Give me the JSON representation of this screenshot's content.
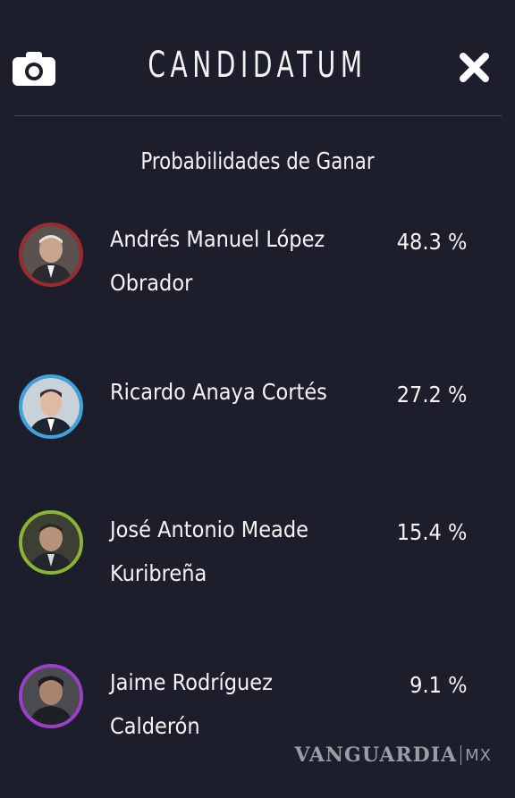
{
  "header": {
    "title": "CANDIDATUM",
    "camera_icon": "camera-icon",
    "close_icon": "close-icon"
  },
  "section_title": "Probabilidades de Ganar",
  "candidates": [
    {
      "name": "Andrés Manuel López\nObrador",
      "probability": "48.3 %",
      "ring_color": "#9e2a2f",
      "probability_value": 48.3
    },
    {
      "name": "Ricardo Anaya Cortés",
      "probability": "27.2 %",
      "ring_color": "#3ea3dc",
      "probability_value": 27.2
    },
    {
      "name": "José Antonio Meade\nKuribreña",
      "probability": "15.4 %",
      "ring_color": "#8ab531",
      "probability_value": 15.4
    },
    {
      "name": "Jaime Rodríguez\nCalderón",
      "probability": "9.1 %",
      "ring_color": "#9b3fc4",
      "probability_value": 9.1
    }
  ],
  "watermark": {
    "brand": "VANGUARDIA",
    "country": "MX"
  }
}
